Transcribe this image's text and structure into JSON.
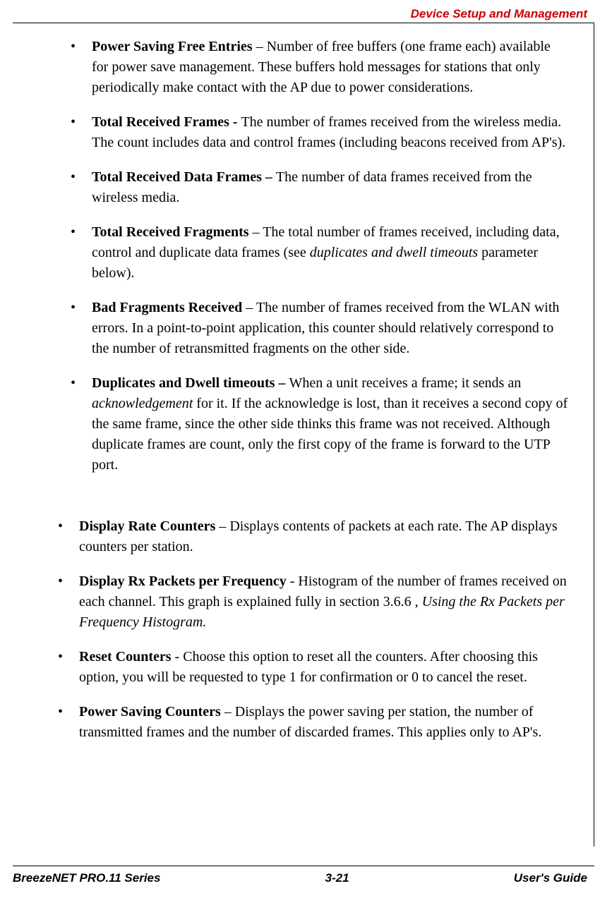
{
  "header": {
    "section_title": "Device Setup and Management"
  },
  "list1": [
    {
      "title": "Power Saving Free Entries",
      "sep": " – ",
      "text": "Number of free buffers (one frame each) available for power save management. These buffers hold messages for stations that only periodically make contact with the AP due to power considerations."
    },
    {
      "title": "Total Received Frames - ",
      "sep": "",
      "text": "The number of frames received from the wireless media. The count includes data and control frames (including beacons received from AP's)."
    },
    {
      "title": "Total Received Data Frames – ",
      "sep": "",
      "text": "The number of data frames received from the wireless media."
    },
    {
      "title": "Total Received Fragments",
      "sep": " – ",
      "text_pre": "The total number of frames received, including data, control and duplicate data frames (see ",
      "italic": "duplicates and dwell timeouts",
      "text_post": " parameter below)."
    },
    {
      "title": "Bad Fragments Received",
      "sep": " – ",
      "text": "The number of frames received from the WLAN with errors. In a point-to-point application, this counter should relatively correspond to the number of retransmitted fragments on the other side."
    },
    {
      "title": "Duplicates and Dwell timeouts – ",
      "sep": "",
      "text_pre": "When a unit receives a frame; it sends an ",
      "italic": "acknowledgement",
      "text_post": " for it. If the acknowledge is lost, than it receives a second copy of the same frame, since the other side thinks this frame was not received. Although duplicate frames are count, only the first copy of the frame is forward to the UTP port."
    }
  ],
  "list2": [
    {
      "title": "Display Rate Counters",
      "sep": " – ",
      "text": "Displays contents of packets at each rate. The AP displays counters per station."
    },
    {
      "title": "Display Rx Packets per Frequency",
      "sep": " - ",
      "text_pre": "Histogram of the number of frames received on each channel. This graph is explained fully in section 3.6.6 , ",
      "italic": "Using the Rx Packets per Frequency Histogram.",
      "text_post": ""
    },
    {
      "title": "Reset Counters ",
      "sep": " - ",
      "text": "Choose this option to reset all the counters. After choosing this option, you will be requested to type 1 for confirmation or 0 to cancel the reset."
    },
    {
      "title": "Power Saving Counters",
      "sep": " – ",
      "text": "Displays the power saving per station, the number of transmitted frames and the number of discarded frames. This applies only to AP's."
    }
  ],
  "footer": {
    "left": "BreezeNET PRO.11 Series",
    "center": "3-21",
    "right": "User's Guide"
  }
}
